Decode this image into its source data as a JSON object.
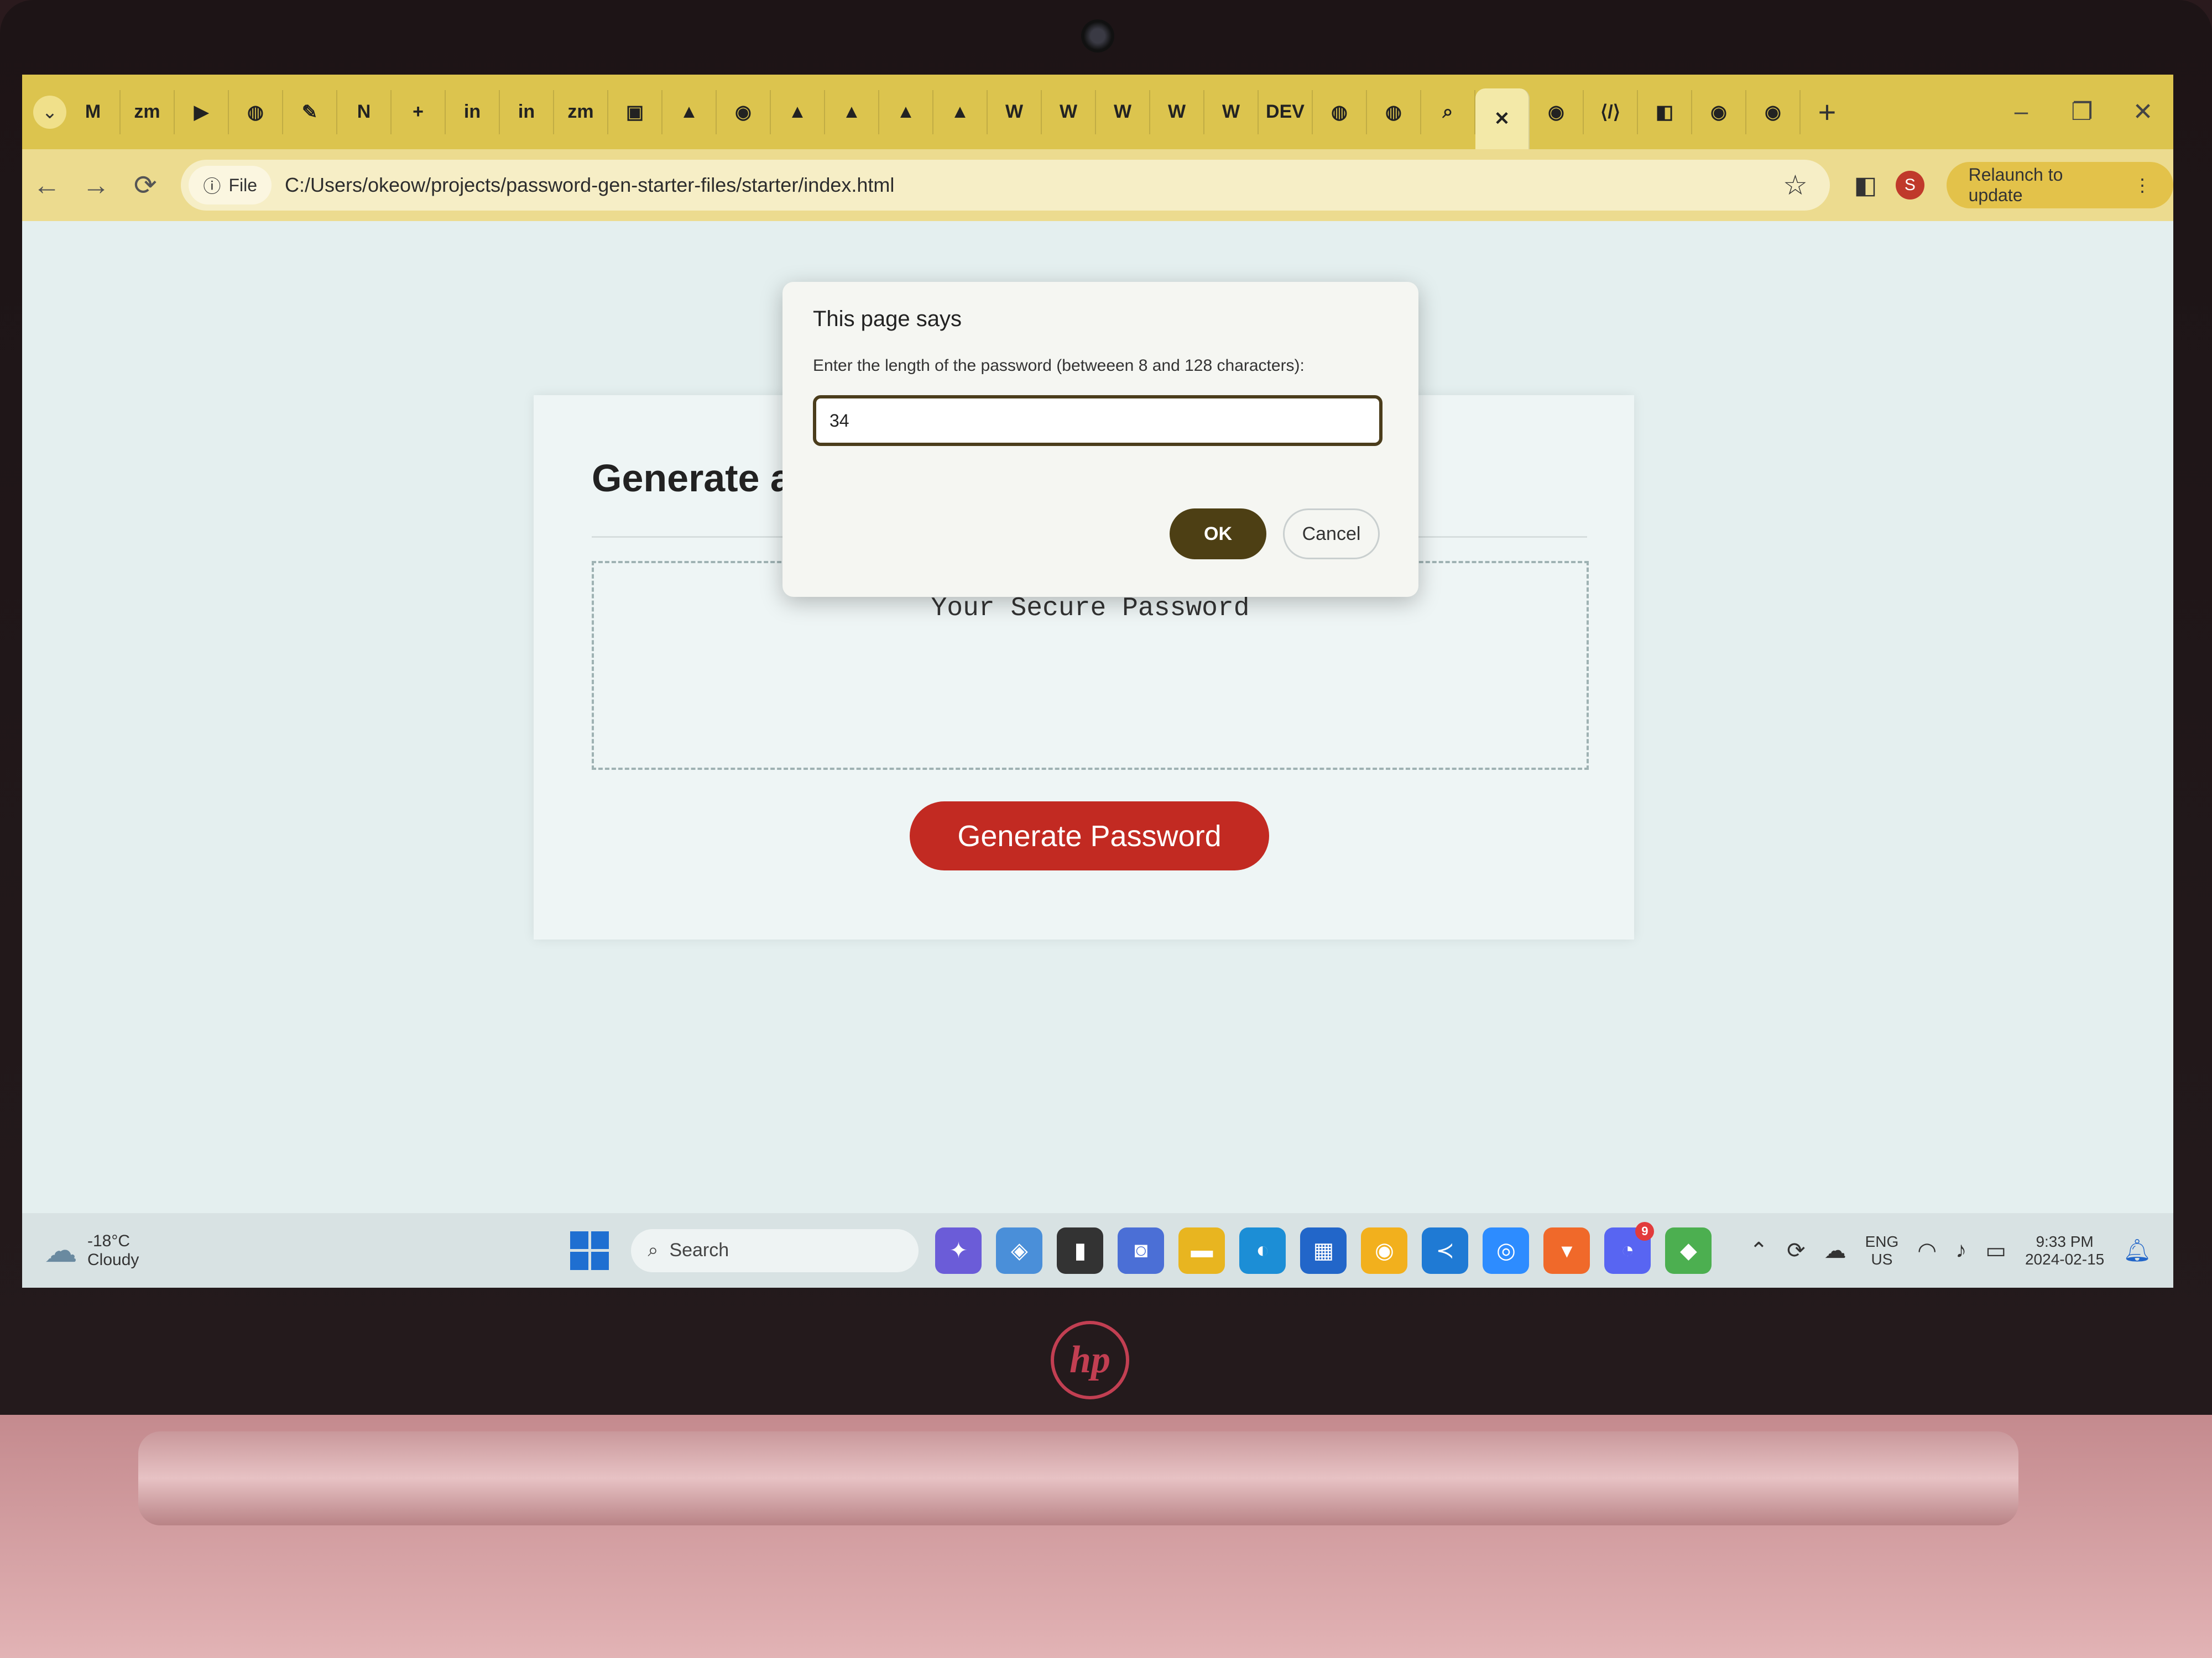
{
  "browser": {
    "tabs": [
      "M",
      "zm",
      "▶",
      "◍",
      "✎",
      "N",
      "+",
      "in",
      "in",
      "zm",
      "▣",
      "▲",
      "◉",
      "▲",
      "▲",
      "▲",
      "▲",
      "W",
      "W",
      "W",
      "W",
      "W",
      "DEV",
      "◍",
      "◍",
      "⌕",
      "✕",
      "◉",
      "⟨/⟩",
      "◧",
      "◉",
      "◉"
    ],
    "new_tab": "+",
    "window_controls": [
      "–",
      "❐",
      "✕"
    ],
    "nav": {
      "back": "←",
      "forward": "→",
      "reload": "⟳"
    },
    "address": {
      "chip_label": "File",
      "url": "C:/Users/okeow/projects/password-gen-starter-files/starter/index.html"
    },
    "profile_initial": "S",
    "relaunch_label": "Relaunch to update",
    "more": "⋮"
  },
  "page": {
    "heading_visible": "Generate a",
    "password_placeholder": "Your Secure Password",
    "generate_button": "Generate Password"
  },
  "dialog": {
    "title": "This page says",
    "message": "Enter the length of the password (betweeen 8 and 128 characters):",
    "input_value": "34",
    "ok_label": "OK",
    "cancel_label": "Cancel"
  },
  "taskbar": {
    "weather_temp": "-18°C",
    "weather_desc": "Cloudy",
    "search_label": "Search",
    "language_top": "ENG",
    "language_bottom": "US",
    "time": "9:33 PM",
    "date": "2024-02-15",
    "discord_badge": "9",
    "app_colors": [
      "#6b5cd8",
      "#4a8fd9",
      "#333333",
      "#4b6fd6",
      "#e8b520",
      "#1c8ed6",
      "#2266c9",
      "#f2b01d",
      "#1f7ad4",
      "#2d8cff",
      "#f0692a",
      "#5865f2",
      "#4caf50"
    ]
  },
  "colors": {
    "tab_bar": "#dcc44e",
    "generate_button": "#c22a22",
    "ok_button": "#4d3f14"
  }
}
